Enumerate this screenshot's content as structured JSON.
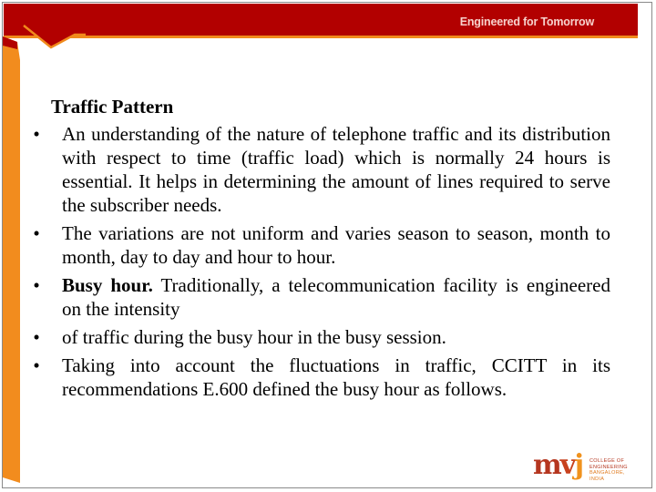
{
  "header": {
    "tagline": "Engineered for Tomorrow"
  },
  "colors": {
    "header_red": "#b20000",
    "accent_orange": "#f08a1c"
  },
  "slide": {
    "title": "Traffic Pattern",
    "bullet_glyph": "•",
    "bullets": [
      {
        "bold": "",
        "text": "An understanding of the nature of telephone traffic and its distribution with respect to time (traffic load) which is normally 24 hours is essential. It helps in determining the amount of lines required to serve the subscriber needs."
      },
      {
        "bold": "",
        "text": "The variations are not uniform and varies season to season, month to month, day to day and hour to hour."
      },
      {
        "bold": "Busy hour.",
        "text": " Traditionally, a telecommunication facility is engineered on the intensity"
      },
      {
        "bold": "",
        "text": "of traffic during the busy hour in the busy session."
      },
      {
        "bold": "",
        "text": "Taking into account the fluctuations in traffic, CCITT in its recommendations E.600 defined the busy hour as follows."
      }
    ]
  },
  "logo": {
    "mark_m": "m",
    "mark_v": "v",
    "mark_j": "j",
    "line1": "COLLEGE OF",
    "line2": "ENGINEERING",
    "line3": "BANGALORE, INDIA"
  }
}
